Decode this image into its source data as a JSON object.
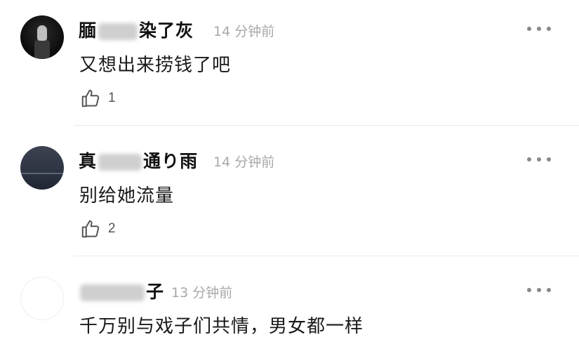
{
  "comments": [
    {
      "name_visible_left": "腼",
      "name_visible_right": "染了灰",
      "time": "14 分钟前",
      "text": "又想出来捞钱了吧",
      "likes": "1",
      "avatar_icon": "dark-figure-avatar"
    },
    {
      "name_visible_left": "真",
      "name_visible_right": "通り雨",
      "time": "14 分钟前",
      "text": "别给她流量",
      "likes": "2",
      "avatar_icon": "night-sky-avatar"
    },
    {
      "name_visible_left": "",
      "name_visible_right": "子",
      "time": "13 分钟前",
      "text": "千万别与戏子们共情，男女都一样",
      "likes": "",
      "avatar_icon": "blank-avatar"
    }
  ],
  "icons": {
    "more": "more-dots-icon",
    "like": "thumbs-up-icon"
  },
  "colors": {
    "name": "#111111",
    "time": "#a8a8a8",
    "text": "#1a1a1a",
    "divider": "#e8e8e8",
    "icon": "#888888"
  }
}
